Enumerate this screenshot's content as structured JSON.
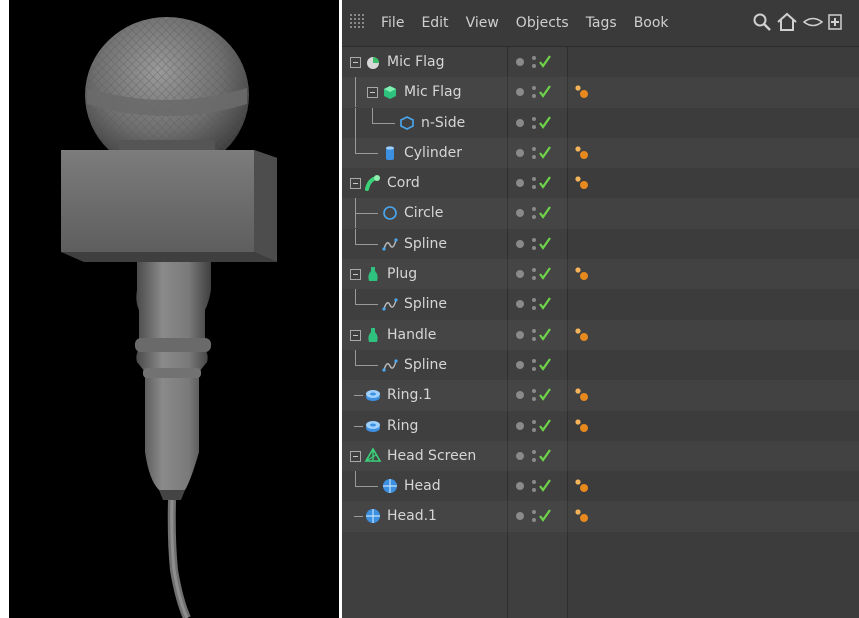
{
  "menu": {
    "items": [
      "File",
      "Edit",
      "View",
      "Objects",
      "Tags",
      "Book"
    ]
  },
  "colors": {
    "panel": "#3f3f3f",
    "text": "#d6d6d6",
    "check": "#6fd34a",
    "tag": "#e8891e"
  },
  "objects": [
    {
      "name": "Mic Flag",
      "depth": 0,
      "expandable": true,
      "icon": "null-object-icon",
      "tag": false
    },
    {
      "name": "Mic Flag",
      "depth": 1,
      "expandable": true,
      "icon": "extrude-icon",
      "tag": true
    },
    {
      "name": "n-Side",
      "depth": 2,
      "expandable": false,
      "icon": "nside-spline-icon",
      "tag": false
    },
    {
      "name": "Cylinder",
      "depth": 1,
      "expandable": false,
      "icon": "cylinder-icon",
      "tag": true
    },
    {
      "name": "Cord",
      "depth": 0,
      "expandable": true,
      "icon": "sweep-icon",
      "tag": true
    },
    {
      "name": "Circle",
      "depth": 1,
      "expandable": false,
      "icon": "circle-spline-icon",
      "tag": false
    },
    {
      "name": "Spline",
      "depth": 1,
      "expandable": false,
      "icon": "spline-icon",
      "tag": false
    },
    {
      "name": "Plug",
      "depth": 0,
      "expandable": true,
      "icon": "lathe-icon",
      "tag": true
    },
    {
      "name": "Spline",
      "depth": 1,
      "expandable": false,
      "icon": "spline-icon",
      "tag": false
    },
    {
      "name": "Handle",
      "depth": 0,
      "expandable": true,
      "icon": "lathe-icon",
      "tag": true
    },
    {
      "name": "Spline",
      "depth": 1,
      "expandable": false,
      "icon": "spline-icon",
      "tag": false
    },
    {
      "name": "Ring.1",
      "depth": 0,
      "expandable": false,
      "icon": "tube-icon",
      "tag": true
    },
    {
      "name": "Ring",
      "depth": 0,
      "expandable": false,
      "icon": "tube-icon",
      "tag": true
    },
    {
      "name": "Head Screen",
      "depth": 0,
      "expandable": true,
      "icon": "atom-array-icon",
      "tag": false
    },
    {
      "name": "Head",
      "depth": 1,
      "expandable": false,
      "icon": "sphere-icon",
      "tag": true
    },
    {
      "name": "Head.1",
      "depth": 0,
      "expandable": false,
      "icon": "sphere-icon",
      "tag": true
    }
  ]
}
